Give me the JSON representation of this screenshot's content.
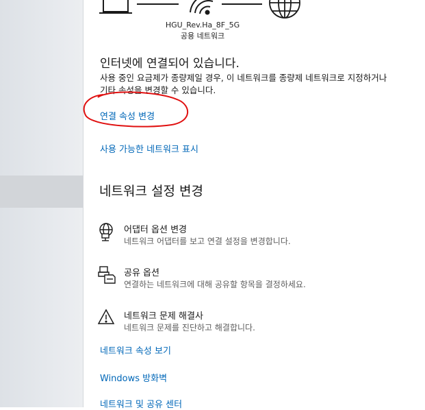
{
  "network": {
    "name": "HGU_Rev.Ha_8F_5G",
    "type": "공용 네트워크"
  },
  "status": {
    "heading": "인터넷에 연결되어 있습니다.",
    "description": "사용 중인 요금제가 종량제일 경우, 이 네트워크를 종량제 네트워크로 지정하거나 기타 속성을 변경할 수 있습니다.",
    "change_properties_link": "연결 속성 변경",
    "show_networks_link": "사용 가능한 네트워크 표시"
  },
  "settings": {
    "title": "네트워크 설정 변경",
    "items": [
      {
        "title": "어댑터 옵션 변경",
        "description": "네트워크 어댑터를 보고 연결 설정을 변경합니다.",
        "icon": "globe-adapter-icon"
      },
      {
        "title": "공유 옵션",
        "description": "연결하는 네트워크에 대해 공유할 항목을 결정하세요.",
        "icon": "sharing-icon"
      },
      {
        "title": "네트워크 문제 해결사",
        "description": "네트워크 문제를 진단하고 해결합니다.",
        "icon": "warning-icon"
      }
    ]
  },
  "links": {
    "view_properties": "네트워크 속성 보기",
    "firewall": "Windows 방화벽",
    "sharing_center": "네트워크 및 공유 센터"
  },
  "colors": {
    "link": "#0067b8",
    "annotation": "#e01010",
    "sidebar": "#e3e6ea"
  }
}
